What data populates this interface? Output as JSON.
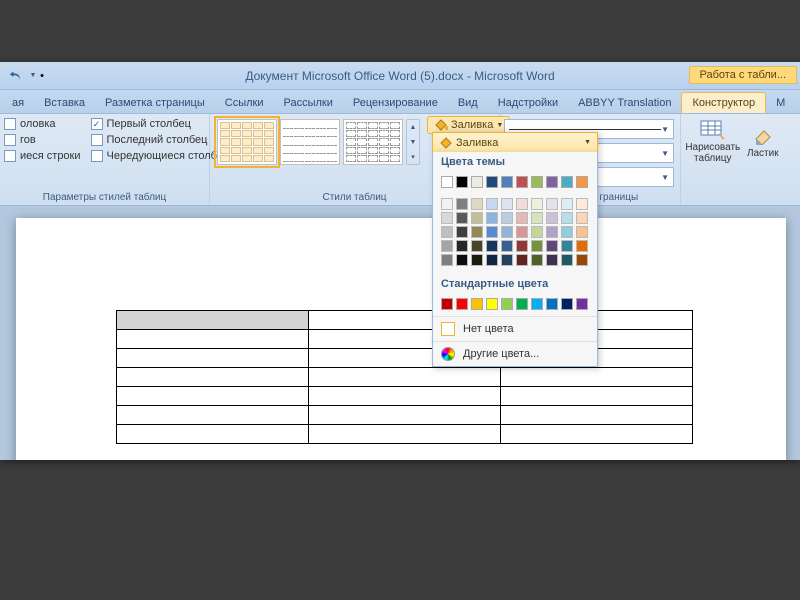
{
  "title": "Документ Microsoft Office Word (5).docx - Microsoft Word",
  "contextTab": "Работа с табли...",
  "tabs": {
    "t0": "ая",
    "t1": "Вставка",
    "t2": "Разметка страницы",
    "t3": "Ссылки",
    "t4": "Рассылки",
    "t5": "Рецензирование",
    "t6": "Вид",
    "t7": "Надстройки",
    "t8": "ABBYY Translation",
    "active": "Конструктор",
    "t9": "М"
  },
  "options": {
    "headerRow": "оловка",
    "totalRow": "гов",
    "bandedRows": "иеся строки",
    "firstCol": "Первый столбец",
    "lastCol": "Последний столбец",
    "bandedCols": "Чередующиеся столбцы",
    "groupLabel": "Параметры стилей таблиц"
  },
  "stylesGroupLabel": "Стили таблиц",
  "shading": {
    "label": "Заливка",
    "header": "Заливка"
  },
  "popup": {
    "themeLabel": "Цвета темы",
    "stdLabel": "Стандартные цвета",
    "noColor": "Нет цвета",
    "moreColors": "Другие цвета...",
    "themeRow": [
      "#ffffff",
      "#000000",
      "#eeece1",
      "#1f497d",
      "#4f81bd",
      "#c0504d",
      "#9bbb59",
      "#8064a2",
      "#4bacc6",
      "#f79646"
    ],
    "shades": [
      [
        "#f2f2f2",
        "#7f7f7f",
        "#ddd9c3",
        "#c6d9f0",
        "#dbe5f1",
        "#f2dcdb",
        "#ebf1dd",
        "#e5e0ec",
        "#dbeef3",
        "#fdeada"
      ],
      [
        "#d8d8d8",
        "#595959",
        "#c4bd97",
        "#8db3e2",
        "#b8cce4",
        "#e5b9b7",
        "#d7e3bc",
        "#ccc1d9",
        "#b7dde8",
        "#fbd5b5"
      ],
      [
        "#bfbfbf",
        "#3f3f3f",
        "#938953",
        "#548dd4",
        "#95b3d7",
        "#d99694",
        "#c3d69b",
        "#b2a2c7",
        "#92cddc",
        "#fac08f"
      ],
      [
        "#a5a5a5",
        "#262626",
        "#494429",
        "#17365d",
        "#366092",
        "#953734",
        "#76923c",
        "#5f497a",
        "#31859b",
        "#e36c09"
      ],
      [
        "#7f7f7f",
        "#0c0c0c",
        "#1d1b10",
        "#0f243e",
        "#244061",
        "#632423",
        "#4f6128",
        "#3f3151",
        "#205867",
        "#974806"
      ]
    ],
    "standard": [
      "#c00000",
      "#ff0000",
      "#ffc000",
      "#ffff00",
      "#92d050",
      "#00b050",
      "#00b0f0",
      "#0070c0",
      "#002060",
      "#7030a0"
    ]
  },
  "drawGroup": {
    "label": "Нарисовать границы",
    "drawTable": "Нарисовать таблицу",
    "eraser": "Ластик"
  }
}
